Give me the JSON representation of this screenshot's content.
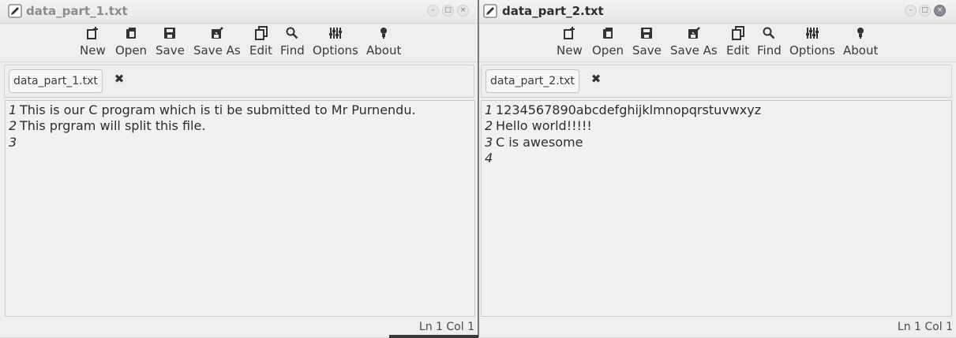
{
  "windows": [
    {
      "title": "data_part_1.txt",
      "toolbar": [
        "New",
        "Open",
        "Save",
        "Save As",
        "Edit",
        "Find",
        "Options",
        "About"
      ],
      "tab_label": "data_part_1.txt",
      "lines": [
        {
          "n": "1",
          "text": "This is our C program which is ti be submitted to Mr Purnendu."
        },
        {
          "n": "2",
          "text": "This prgram will split this file."
        },
        {
          "n": "3",
          "text": ""
        }
      ],
      "status": "Ln 1 Col 1"
    },
    {
      "title": "data_part_2.txt",
      "toolbar": [
        "New",
        "Open",
        "Save",
        "Save As",
        "Edit",
        "Find",
        "Options",
        "About"
      ],
      "tab_label": "data_part_2.txt",
      "lines": [
        {
          "n": "1",
          "text": "1234567890abcdefghijklmnopqrstuvwxyz"
        },
        {
          "n": "2",
          "text": "Hello world!!!!!"
        },
        {
          "n": "3",
          "text": "C is awesome"
        },
        {
          "n": "4",
          "text": ""
        }
      ],
      "status": "Ln 1 Col 1"
    }
  ],
  "icons": {
    "title": "pencil-icon",
    "toolbar": [
      "new-file-icon",
      "open-icon",
      "save-icon",
      "save-as-icon",
      "edit-icon",
      "find-icon",
      "options-icon",
      "about-icon"
    ],
    "tab_close": "close-x-icon",
    "tab_close_glyph": "✖",
    "window_controls": [
      "minimize-icon",
      "maximize-icon",
      "close-icon"
    ]
  }
}
